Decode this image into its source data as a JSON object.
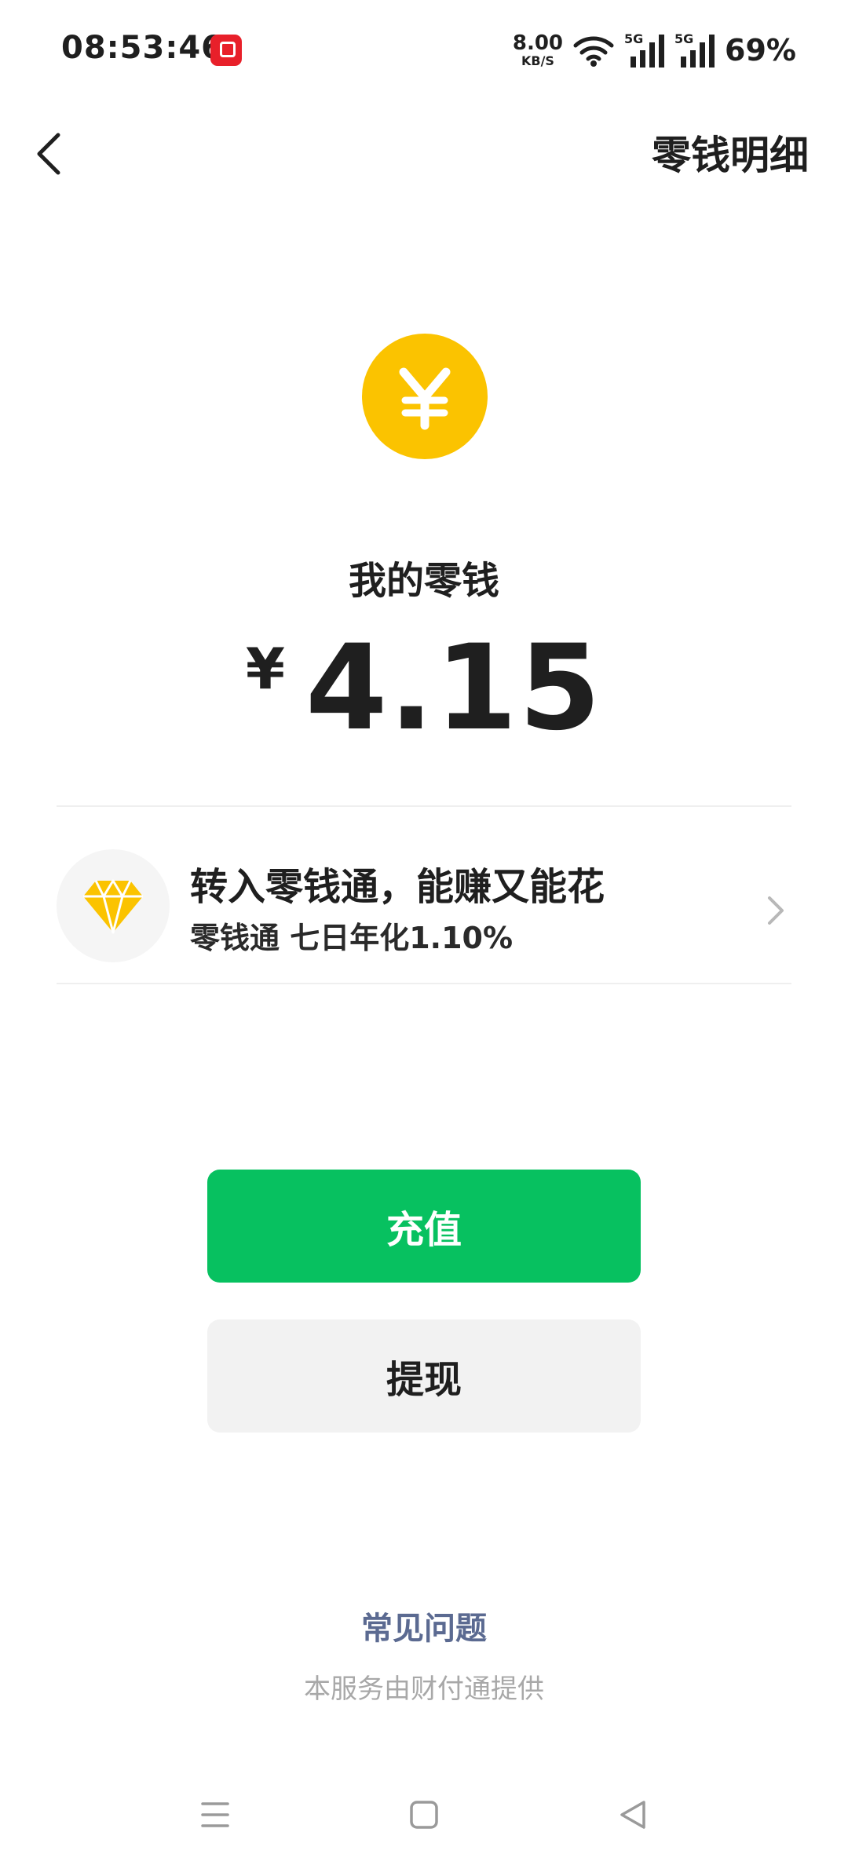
{
  "status_bar": {
    "time": "08:53:46",
    "net_speed_value": "8.00",
    "net_speed_unit": "KB/S",
    "sim1_label": "5G",
    "sim2_label": "5G",
    "battery": "69%"
  },
  "header": {
    "back_icon": "chevron-left-icon",
    "details_link": "零钱明细"
  },
  "wallet": {
    "coin_icon": "yuan-coin-icon",
    "label": "我的零钱",
    "currency_symbol": "¥",
    "amount": "4.15"
  },
  "promo": {
    "icon": "diamond-icon",
    "title": "转入零钱通，能赚又能花",
    "subtitle": "零钱通 七日年化1.10%",
    "arrow_icon": "chevron-right-icon"
  },
  "actions": {
    "recharge_label": "充值",
    "withdraw_label": "提现"
  },
  "footer": {
    "faq_link": "常见问题",
    "provider_note": "本服务由财付通提供"
  },
  "colors": {
    "accent_green": "#07c160",
    "coin_yellow": "#fbc300",
    "link_blue": "#5b6a91",
    "muted_gray": "#a8a8a8"
  }
}
